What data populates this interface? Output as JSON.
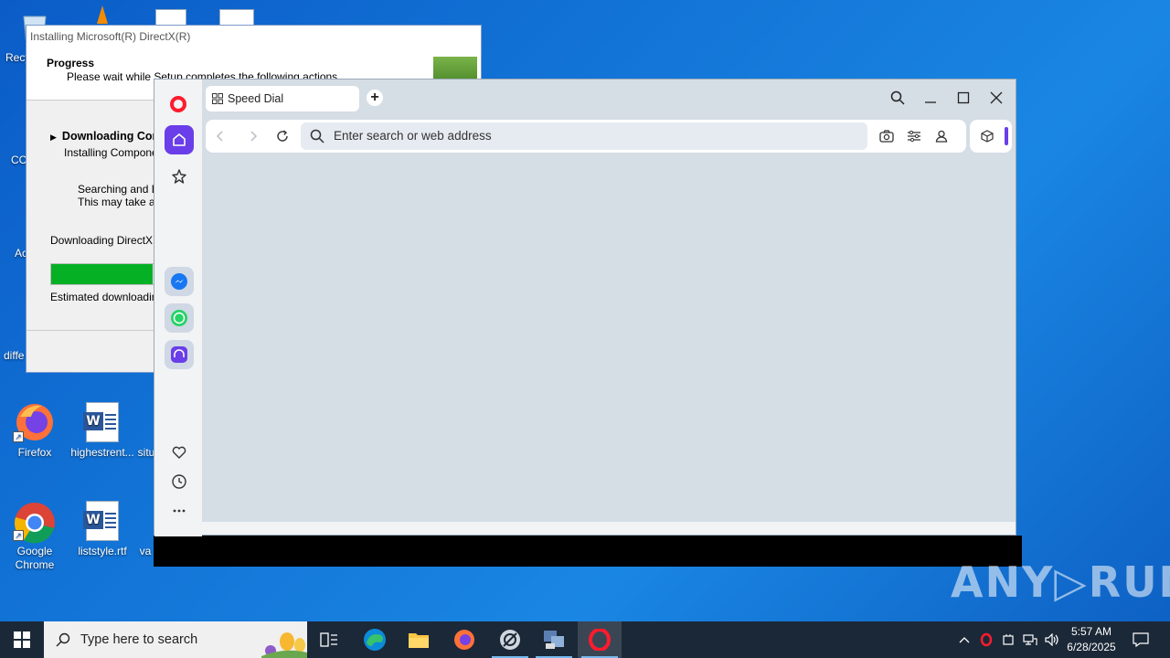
{
  "desktop": {
    "icons": [
      {
        "label": "Recy"
      },
      {
        "label": "CC"
      },
      {
        "label": "Ac"
      },
      {
        "label": "diffe"
      },
      {
        "label": "Firefox"
      },
      {
        "label": "highestrent..."
      },
      {
        "label": "situ"
      },
      {
        "label": "Google Chrome"
      },
      {
        "label": "liststyle.rtf"
      },
      {
        "label": "va"
      }
    ]
  },
  "directx": {
    "title": "Installing Microsoft(R) DirectX(R)",
    "header_title": "Progress",
    "header_sub": "Please wait while Setup completes the following actions.",
    "step_title": "Downloading Com",
    "step_sub": "Installing Component",
    "line1": "Searching and Do",
    "line2": "This may take a fe",
    "download_label": "Downloading DirectX SI",
    "progress_fraction": 0.7,
    "estimate_label": "Estimated downloading t"
  },
  "opera": {
    "tab_title": "Speed Dial",
    "new_tab": "+",
    "address_placeholder": "Enter search or web address",
    "accent": "#6a3ee8",
    "logo_color": "#ff1b2d"
  },
  "watermark": "ANY RUN",
  "taskbar": {
    "search_placeholder": "Type here to search",
    "time": "5:57 AM",
    "date": "6/28/2025"
  }
}
